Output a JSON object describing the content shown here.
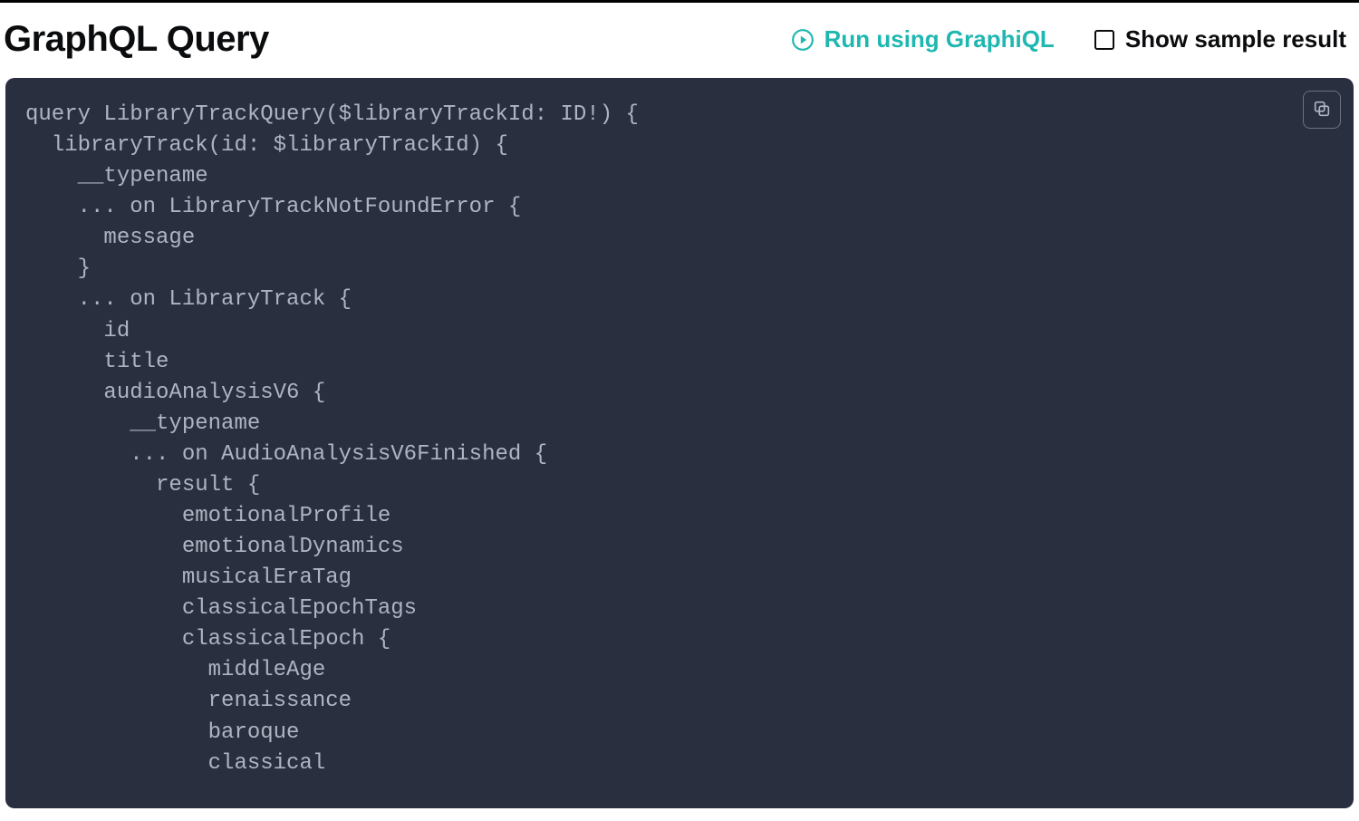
{
  "header": {
    "title": "GraphQL Query",
    "run_link_label": "Run using GraphiQL",
    "checkbox_label": "Show sample result"
  },
  "icons": {
    "play": "play-circle-icon",
    "copy": "copy-icon"
  },
  "code": {
    "text": "query LibraryTrackQuery($libraryTrackId: ID!) {\n  libraryTrack(id: $libraryTrackId) {\n    __typename\n    ... on LibraryTrackNotFoundError {\n      message\n    }\n    ... on LibraryTrack {\n      id\n      title\n      audioAnalysisV6 {\n        __typename\n        ... on AudioAnalysisV6Finished {\n          result {\n            emotionalProfile\n            emotionalDynamics\n            musicalEraTag\n            classicalEpochTags\n            classicalEpoch {\n              middleAge\n              renaissance\n              baroque\n              classical"
  },
  "colors": {
    "accent": "#1fb7b0",
    "code_bg": "#2a2f3f",
    "code_fg": "#aeb4c2"
  }
}
